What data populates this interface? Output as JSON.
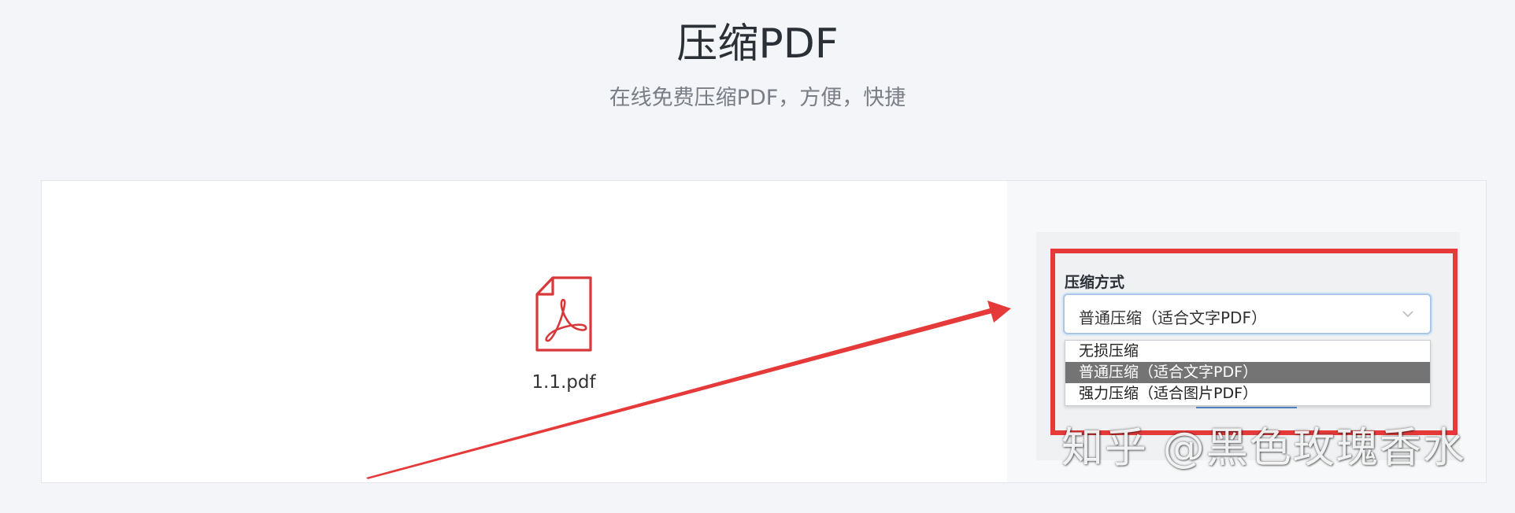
{
  "header": {
    "title": "压缩PDF",
    "subtitle": "在线免费压缩PDF，方便，快捷"
  },
  "file": {
    "name": "1.1.pdf",
    "icon": "pdf-file-icon"
  },
  "compression": {
    "label": "压缩方式",
    "selected": "普通压缩（适合文字PDF）",
    "options": [
      "无损压缩",
      "普通压缩（适合文字PDF）",
      "强力压缩（适合图片PDF）"
    ],
    "selected_index": 1
  },
  "watermark": "知乎 @黑色玫瑰香水",
  "colors": {
    "annotation_red": "#e63939",
    "pdf_icon_red": "#d9383a",
    "selected_option_bg": "#747474",
    "select_border": "#a9c7e7"
  }
}
